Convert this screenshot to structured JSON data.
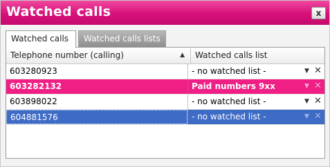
{
  "window": {
    "title": "Watched calls",
    "close_label": "x"
  },
  "tabs": [
    {
      "label": "Watched calls",
      "active": true
    },
    {
      "label": "Watched calls lists",
      "active": false
    }
  ],
  "table": {
    "columns": [
      "Telephone number (calling)",
      "Watched calls list"
    ],
    "sort_column": "Telephone number (calling)",
    "sort_direction": "ascending",
    "rows": [
      {
        "number": "603280923",
        "list": "- no watched list -",
        "style": "normal"
      },
      {
        "number": "603282132",
        "list": "Paid numbers 9xx",
        "style": "highlighted"
      },
      {
        "number": "603898022",
        "list": "- no watched list -",
        "style": "normal"
      },
      {
        "number": "604881576",
        "list": "- no watched list -",
        "style": "selected"
      }
    ]
  },
  "colors": {
    "title_bar": "#d7107a",
    "highlight_row": "#ef1f86",
    "selected_row": "#3d6bc6"
  },
  "icons": {
    "dropdown": "chevron-down-icon",
    "remove": "close-icon",
    "sort": "sort-ascending-icon"
  }
}
